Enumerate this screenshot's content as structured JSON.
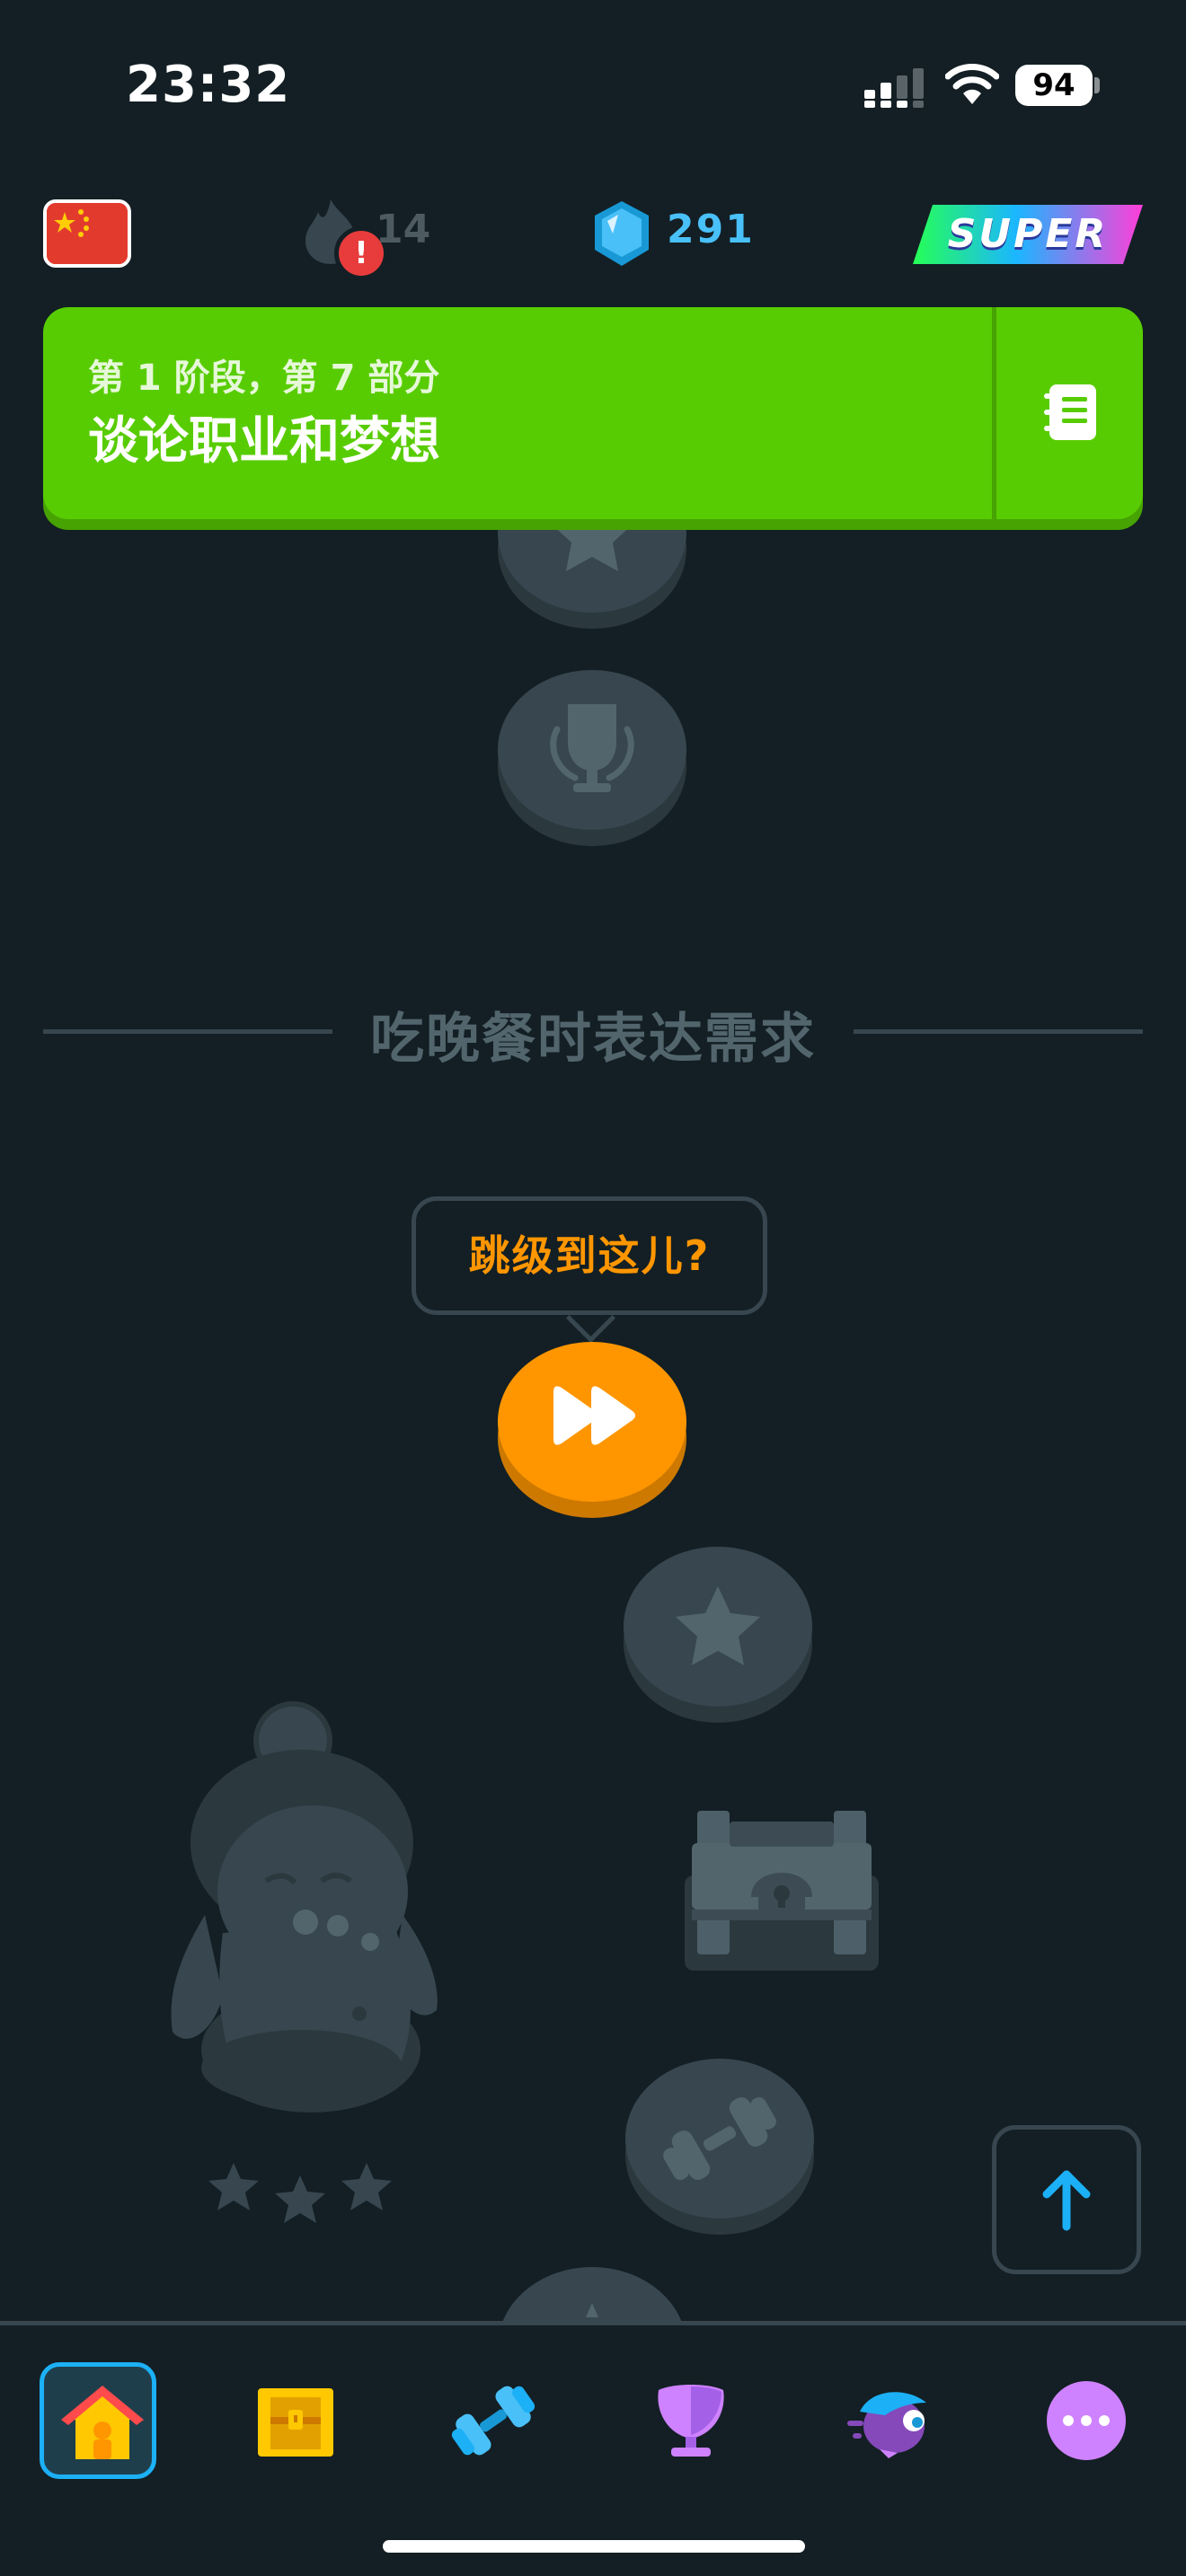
{
  "status_bar": {
    "time": "23:32",
    "battery": "94"
  },
  "top_bar": {
    "course_flag": "china-flag-icon",
    "streak_count": "14",
    "streak_alert": "!",
    "gems_count": "291",
    "super_label": "SUPER"
  },
  "unit_banner": {
    "subtitle": "第 1 阶段，第 7 部分",
    "title": "谈论职业和梦想",
    "guide_icon": "notebook-icon"
  },
  "section": {
    "title": "吃晚餐时表达需求"
  },
  "jump": {
    "tooltip": "跳级到这儿?",
    "icon": "fast-forward-icon"
  },
  "path_nodes": [
    "star-icon",
    "trophy-icon",
    "fast-forward-icon",
    "star-icon",
    "chest-icon",
    "dumbbell-icon",
    "star-icon"
  ],
  "colors": {
    "background": "#131f24",
    "banner_green": "#58cc02",
    "jump_orange": "#ff9600",
    "gem_blue": "#49c0f8",
    "locked_node": "#37464f"
  },
  "bottom_nav": [
    {
      "name": "learn",
      "icon": "home-icon"
    },
    {
      "name": "chest",
      "icon": "treasure-chest-icon"
    },
    {
      "name": "practice",
      "icon": "dumbbell-icon"
    },
    {
      "name": "leaderboard",
      "icon": "trophy-icon"
    },
    {
      "name": "characters",
      "icon": "bird-icon"
    },
    {
      "name": "more",
      "icon": "more-icon"
    }
  ]
}
